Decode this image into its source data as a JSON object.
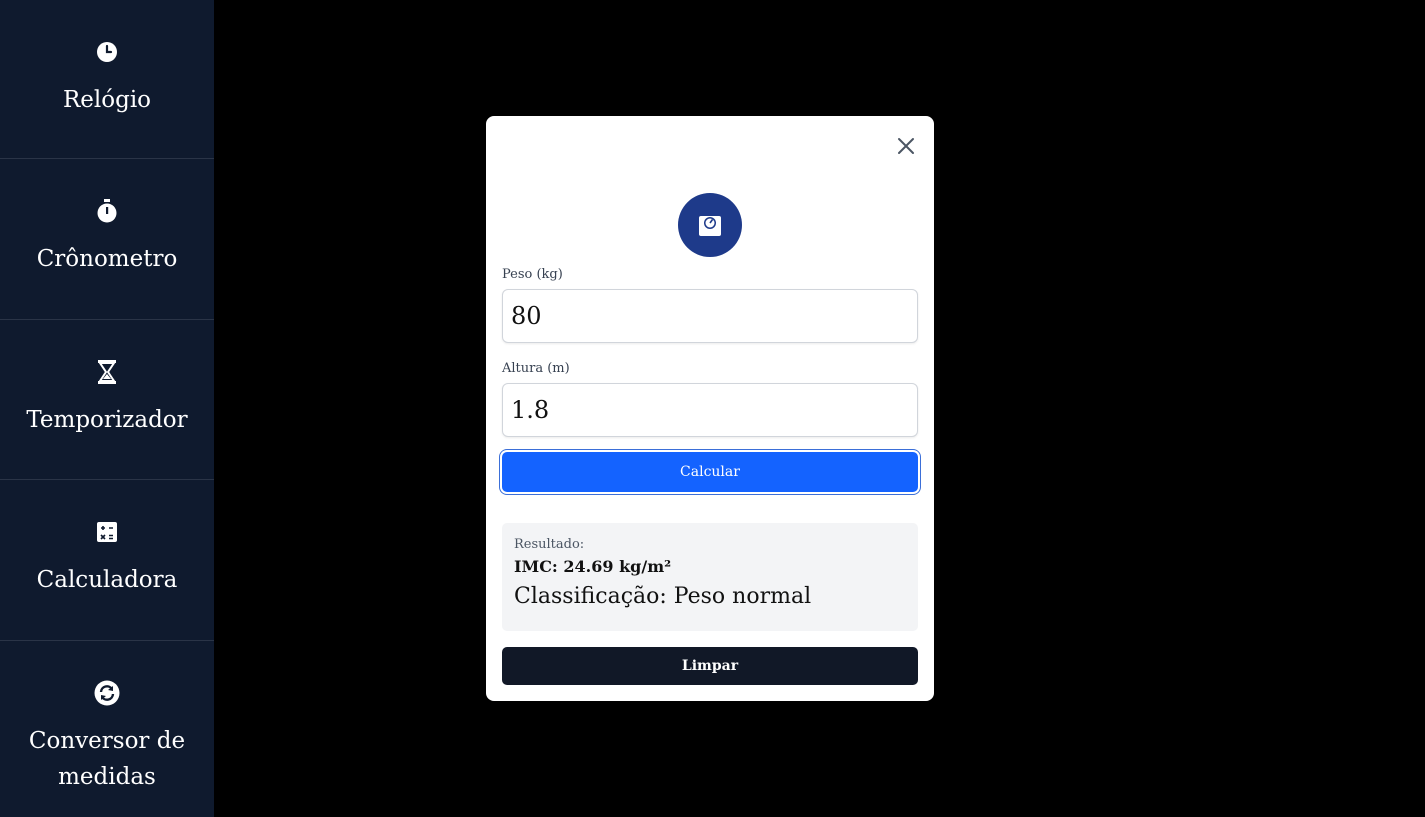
{
  "sidebar": {
    "items": [
      {
        "label": "Relógio",
        "icon": "clock-icon"
      },
      {
        "label": "Crônometro",
        "icon": "stopwatch-icon"
      },
      {
        "label": "Temporizador",
        "icon": "hourglass-icon"
      },
      {
        "label": "Calculadora",
        "icon": "calculator-icon"
      },
      {
        "label": "Conversor de medidas",
        "icon": "convert-icon"
      }
    ]
  },
  "modal": {
    "icon": "scale-icon",
    "weight": {
      "label": "Peso (kg)",
      "value": "80"
    },
    "height": {
      "label": "Altura (m)",
      "value": "1.8"
    },
    "calculate_label": "Calcular",
    "result": {
      "label": "Resultado:",
      "imc": "IMC: 24.69 kg/m²",
      "classification": "Classificação: Peso normal"
    },
    "clear_label": "Limpar"
  },
  "colors": {
    "sidebar_bg": "#0f1a2e",
    "primary": "#1463ff",
    "badge": "#1e3a8a",
    "dark_button": "#111827"
  }
}
